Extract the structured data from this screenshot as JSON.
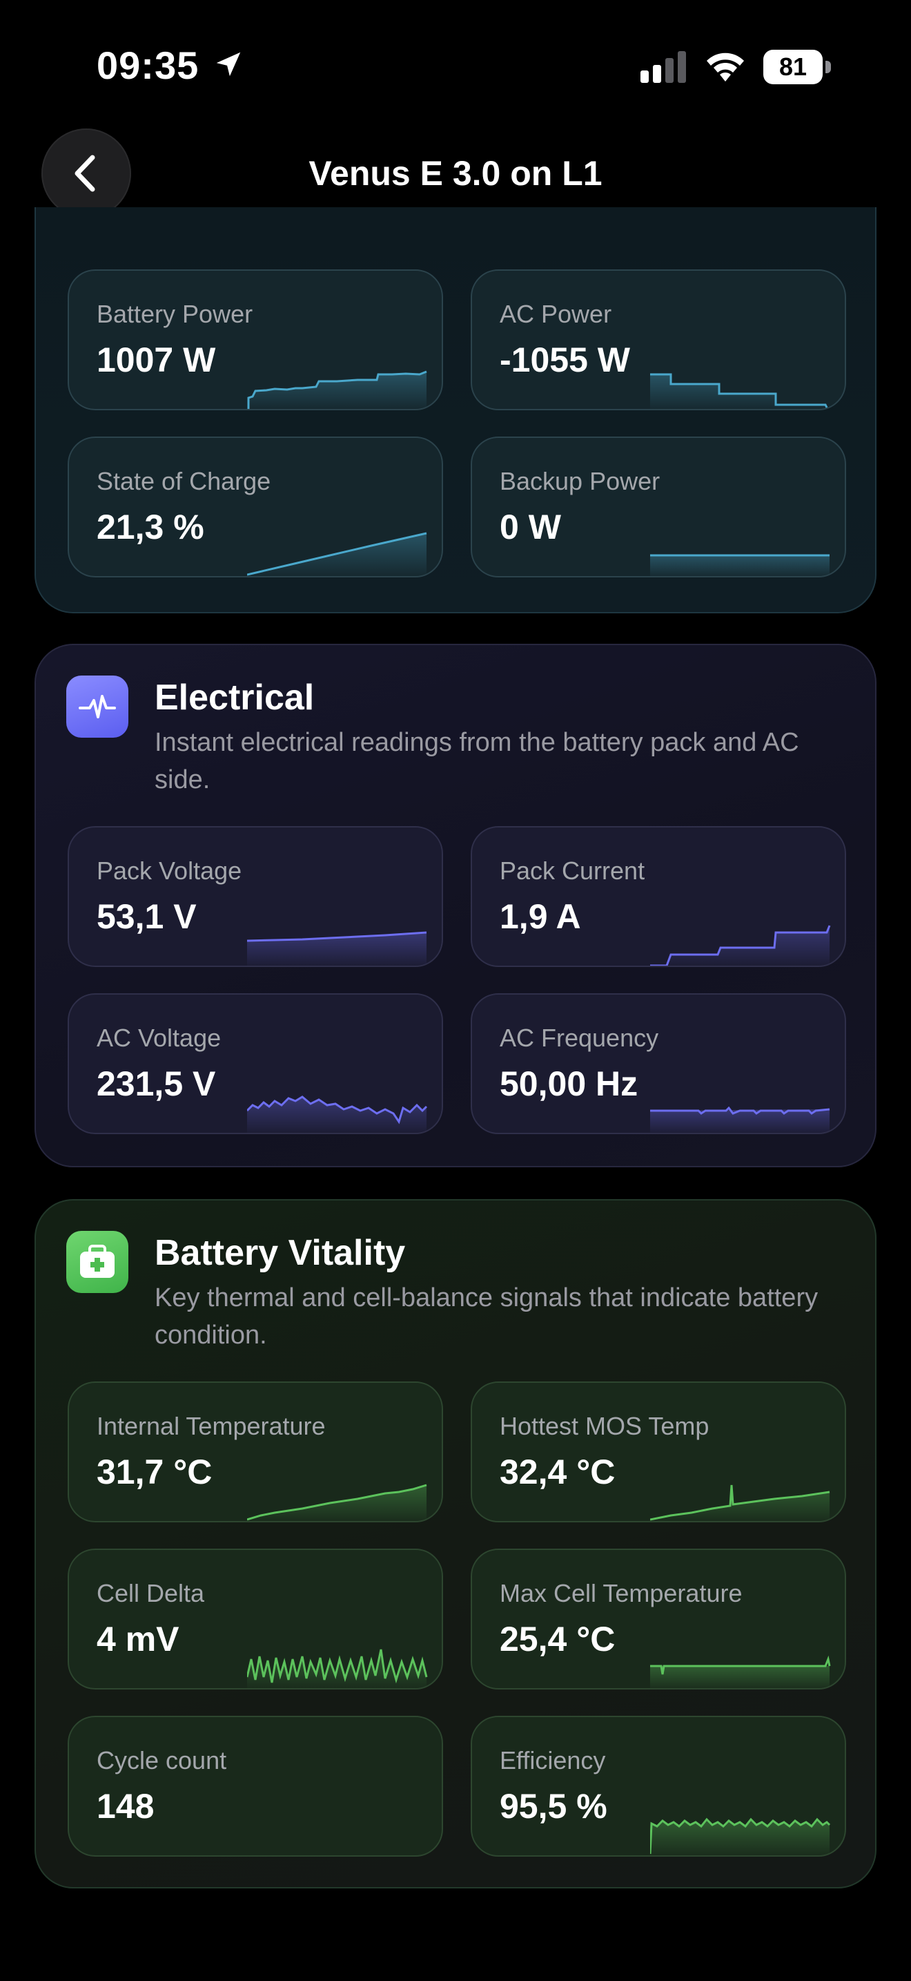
{
  "status_bar": {
    "time": "09:35",
    "battery_level": "81"
  },
  "header": {
    "title": "Venus E 3.0 on L1"
  },
  "sections": {
    "power": {
      "accent": "#4aa8cc",
      "cards": [
        {
          "label": "Battery Power",
          "value": "1007 W"
        },
        {
          "label": "AC Power",
          "value": "-1055 W"
        },
        {
          "label": "State of Charge",
          "value": "21,3 %"
        },
        {
          "label": "Backup Power",
          "value": "0 W"
        }
      ]
    },
    "electrical": {
      "title": "Electrical",
      "subtitle": "Instant electrical readings from the battery pack and AC side.",
      "icon": "waveform-icon",
      "accent": "#6d6ef0",
      "cards": [
        {
          "label": "Pack Voltage",
          "value": "53,1 V"
        },
        {
          "label": "Pack Current",
          "value": "1,9 A"
        },
        {
          "label": "AC Voltage",
          "value": "231,5 V"
        },
        {
          "label": "AC Frequency",
          "value": "50,00 Hz"
        }
      ]
    },
    "vitality": {
      "title": "Battery Vitality",
      "subtitle": "Key thermal and cell-balance signals that indicate battery condition.",
      "icon": "medical-kit-icon",
      "accent": "#5cc25c",
      "cards": [
        {
          "label": "Internal Temperature",
          "value": "31,7 °C"
        },
        {
          "label": "Hottest MOS Temp",
          "value": "32,4 °C"
        },
        {
          "label": "Cell Delta",
          "value": "4 mV"
        },
        {
          "label": "Max Cell Temperature",
          "value": "25,4 °C"
        },
        {
          "label": "Cycle count",
          "value": "148"
        },
        {
          "label": "Efficiency",
          "value": "95,5 %"
        }
      ]
    }
  }
}
